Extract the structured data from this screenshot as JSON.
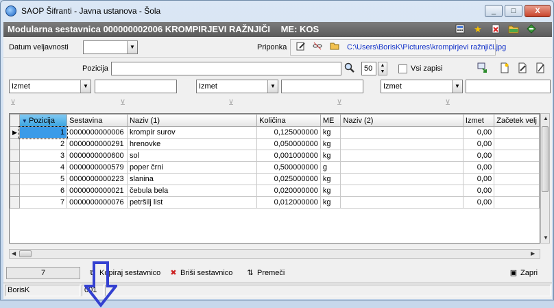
{
  "window": {
    "title": "SAOP Šifranti - Javna ustanova - Šola",
    "minimize_label": "_",
    "maximize_label": "□",
    "close_label": "X"
  },
  "header": {
    "title": "Modularna sestavnica 000000002006 KROMPIRJEVI RAŽNJIČI",
    "me_label": "ME: KOS"
  },
  "top": {
    "validity_label": "Datum veljavnosti",
    "validity_value": "",
    "attachment_label": "Priponka",
    "attachment_path": "C:\\Users\\BorisK\\Pictures\\krompirjevi ražnjiči.jpg"
  },
  "search": {
    "position_label": "Pozicija",
    "position_value": "",
    "page_size": "50",
    "all_records_label": "Vsi zapisi"
  },
  "filters": [
    {
      "field": "Izmet",
      "value": ""
    },
    {
      "field": "Izmet",
      "value": ""
    },
    {
      "field": "Izmet",
      "value": ""
    }
  ],
  "table": {
    "columns": [
      "Pozicija",
      "Sestavina",
      "Naziv (1)",
      "Količina",
      "ME",
      "Naziv (2)",
      "Izmet",
      "Začetek velj"
    ],
    "rows": [
      {
        "pos": "1",
        "code": "0000000000006",
        "name": "krompir surov",
        "qty": "0,125000000",
        "me": "kg",
        "name2": "",
        "waste": "0,00"
      },
      {
        "pos": "2",
        "code": "0000000000291",
        "name": "hrenovke",
        "qty": "0,050000000",
        "me": "kg",
        "name2": "",
        "waste": "0,00"
      },
      {
        "pos": "3",
        "code": "0000000000600",
        "name": "sol",
        "qty": "0,001000000",
        "me": "kg",
        "name2": "",
        "waste": "0,00"
      },
      {
        "pos": "4",
        "code": "0000000000579",
        "name": "poper črni",
        "qty": "0,500000000",
        "me": "g",
        "name2": "",
        "waste": "0,00"
      },
      {
        "pos": "5",
        "code": "0000000000223",
        "name": "slanina",
        "qty": "0,025000000",
        "me": "kg",
        "name2": "",
        "waste": "0,00"
      },
      {
        "pos": "6",
        "code": "0000000000021",
        "name": "čebula bela",
        "qty": "0,020000000",
        "me": "kg",
        "name2": "",
        "waste": "0,00"
      },
      {
        "pos": "7",
        "code": "0000000000076",
        "name": "petršilj list",
        "qty": "0,012000000",
        "me": "kg",
        "name2": "",
        "waste": "0,00"
      }
    ]
  },
  "footer": {
    "record_count": "7",
    "copy_label": "Kopiraj sestavnico",
    "delete_label": "Briši sestavnico",
    "move_label": "Premeči",
    "close_label": "Zapri"
  },
  "status": {
    "user": "BorisK",
    "code": "001"
  },
  "colors": {
    "header_bg": "#6b6b6b",
    "link": "#1030c8",
    "arrow": "#3340d0",
    "sorted_header": "#3aa3e0"
  }
}
